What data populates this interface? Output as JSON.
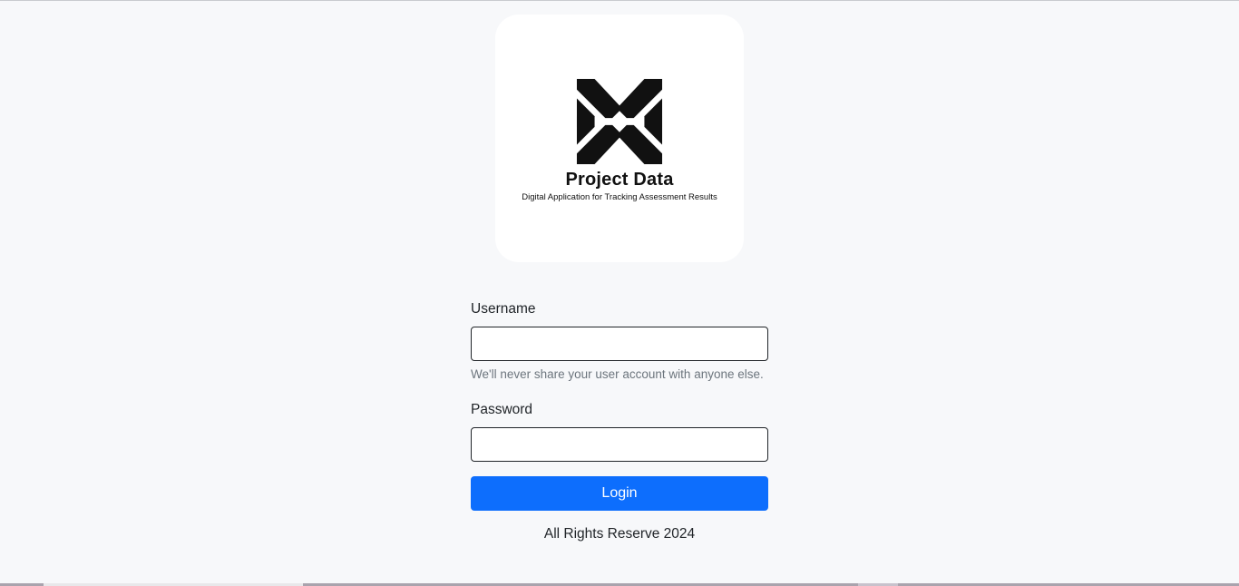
{
  "brand": {
    "logo_icon": "project-data-x-logo",
    "title": "Project Data",
    "subtitle": "Digital Application for Tracking Assessment Results"
  },
  "form": {
    "username_label": "Username",
    "username_value": "",
    "username_help": "We'll never share your user account with anyone else.",
    "password_label": "Password",
    "password_value": "",
    "login_label": "Login"
  },
  "footer": {
    "text": "All Rights Reserve 2024"
  },
  "colors": {
    "page_background": "#f7f8fa",
    "primary_button": "#0d6efd",
    "help_text": "#6c757d"
  }
}
